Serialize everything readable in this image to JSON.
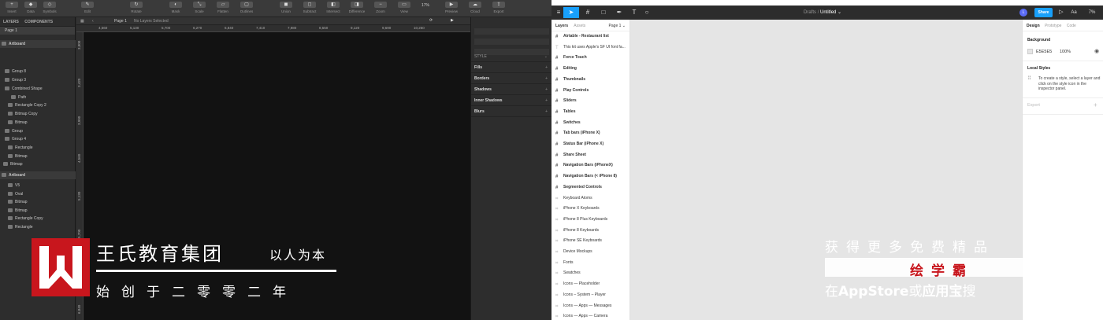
{
  "sketch": {
    "toolbar": [
      {
        "icon": "plus-icon",
        "label": "Insert"
      },
      {
        "icon": "data-icon",
        "label": "Data"
      },
      {
        "icon": "symbols-icon",
        "label": "Symbols"
      },
      {
        "icon": "edit-icon",
        "label": "Edit"
      },
      {
        "icon": "rotate-icon",
        "label": "Rotate"
      },
      {
        "icon": "mask-icon",
        "label": "Mask"
      },
      {
        "icon": "scale-icon",
        "label": "Scale"
      },
      {
        "icon": "flatten-icon",
        "label": "Flatten"
      },
      {
        "icon": "outline-icon",
        "label": "Outlines"
      },
      {
        "icon": "union-icon",
        "label": "Union"
      },
      {
        "icon": "subtract-icon",
        "label": "Subtract"
      },
      {
        "icon": "intersect-icon",
        "label": "Intersect"
      },
      {
        "icon": "difference-icon",
        "label": "Difference"
      },
      {
        "icon": "zoom-icon",
        "label": "Zoom"
      },
      {
        "icon": "view-icon",
        "label": "View"
      },
      {
        "icon": "preview-icon",
        "label": "Preview"
      },
      {
        "icon": "cloud-icon",
        "label": "Cloud"
      },
      {
        "icon": "export-icon",
        "label": "Export"
      }
    ],
    "zoom_value": "17%",
    "layers_tabs": [
      "LAYERS",
      "COMPONENTS"
    ],
    "page": "Page 1",
    "layers": [
      {
        "label": "Artboard",
        "kind": "artboard"
      },
      {
        "label": "Group 8",
        "kind": "group"
      },
      {
        "label": "Group 3",
        "kind": "group"
      },
      {
        "label": "Combined Shape",
        "kind": "shape"
      },
      {
        "label": "Path",
        "kind": "path"
      },
      {
        "label": "Rectangle Copy 2",
        "kind": "rect"
      },
      {
        "label": "Bitmap Copy",
        "kind": "bitmap"
      },
      {
        "label": "Bitmap",
        "kind": "bitmap"
      },
      {
        "label": "Group",
        "kind": "group"
      },
      {
        "label": "Group 4",
        "kind": "group"
      },
      {
        "label": "Rectangle",
        "kind": "rect"
      },
      {
        "label": "Bitmap",
        "kind": "bitmap"
      },
      {
        "label": "Bitmap",
        "kind": "bitmap"
      },
      {
        "label": "Artboard",
        "kind": "artboard"
      },
      {
        "label": "V5",
        "kind": "text"
      },
      {
        "label": "Oval",
        "kind": "oval"
      },
      {
        "label": "Bitmap",
        "kind": "bitmap"
      },
      {
        "label": "Bitmap",
        "kind": "bitmap"
      },
      {
        "label": "Rectangle Copy",
        "kind": "rect"
      },
      {
        "label": "Rectangle",
        "kind": "rect"
      }
    ],
    "canvas_page": "Page 1",
    "canvas_status": "No Layers Selected",
    "ruler_top": [
      "4,560",
      "5,130",
      "5,700",
      "6,270",
      "6,840",
      "7,410",
      "7,980",
      "8,550",
      "9,120",
      "9,690",
      "10,260"
    ],
    "ruler_left": [
      "3,800",
      "3,420",
      "3,990",
      "4,560",
      "5,130",
      "5,700",
      "6,270",
      "6,840"
    ],
    "inspector": [
      "STYLE",
      "Fills",
      "Borders",
      "Shadows",
      "Inner Shadows",
      "Blurs"
    ]
  },
  "figma": {
    "breadcrumb_root": "Drafts",
    "breadcrumb_sep": "/",
    "file_name": "Untitled",
    "share": "Share",
    "avatar": "L",
    "zoom": "7%",
    "layers_tabs": [
      "Layers",
      "Assets"
    ],
    "page": "Page 1",
    "layers": [
      {
        "label": "Airtable - Restaurant list",
        "bold": true
      },
      {
        "label": "This kit uses Apple's SF UI font fa...",
        "bold": false,
        "text": true
      },
      {
        "label": "Force Touch",
        "bold": true
      },
      {
        "label": "Editing",
        "bold": true
      },
      {
        "label": "Thumbnails",
        "bold": true
      },
      {
        "label": "Play Controls",
        "bold": true
      },
      {
        "label": "Sliders",
        "bold": true
      },
      {
        "label": "Tables",
        "bold": true
      },
      {
        "label": "Switches",
        "bold": true
      },
      {
        "label": "Tab bars (iPhone X)",
        "bold": true
      },
      {
        "label": "Status Bar (iPhone X)",
        "bold": true
      },
      {
        "label": "Share Sheet",
        "bold": true
      },
      {
        "label": "Navigation Bars (iPhoneX)",
        "bold": true
      },
      {
        "label": "Navigation Bars (< iPhone 8)",
        "bold": true
      },
      {
        "label": "Segmented Controls",
        "bold": true
      },
      {
        "label": "Keyboard Atoms",
        "bold": false
      },
      {
        "label": "iPhone X Keyboards",
        "bold": false
      },
      {
        "label": "iPhone 8 Plus Keyboards",
        "bold": false
      },
      {
        "label": "iPhone 8 Keyboards",
        "bold": false
      },
      {
        "label": "iPhone SE Keyboards",
        "bold": false
      },
      {
        "label": "Device Mockups",
        "bold": false
      },
      {
        "label": "Fonts",
        "bold": false
      },
      {
        "label": "Swatches",
        "bold": false
      },
      {
        "label": "Icons — Placeholder",
        "bold": false
      },
      {
        "label": "Icons – System – Player",
        "bold": false
      },
      {
        "label": "Icons — Apps — Messages",
        "bold": false
      },
      {
        "label": "Icons — Apps — Camera",
        "bold": false
      }
    ],
    "props_tabs": [
      "Design",
      "Prototype",
      "Code"
    ],
    "background_title": "Background",
    "background_hex": "E5E5E5",
    "background_opacity": "100%",
    "local_styles_title": "Local Styles",
    "local_styles_hint": "To create a style, select a layer and click on the style icon in the inspector panel.",
    "export_title": "Export"
  },
  "watermark": {
    "title": "王氏教育集团",
    "slogan": "以人为本",
    "subtitle": "始创于二零零二年",
    "right_line1": "获得更多免费精品",
    "right_line2": "绘学霸",
    "right_line3_a": "在",
    "right_line3_b": "AppStore",
    "right_line3_c": "或",
    "right_line3_d": "应用宝",
    "right_line3_e": "搜"
  },
  "colors": {
    "brand_red": "#c8161d",
    "figma_blue": "#18a0fb",
    "canvas_dark": "#121212",
    "figma_canvas": "#e5e5e5"
  }
}
